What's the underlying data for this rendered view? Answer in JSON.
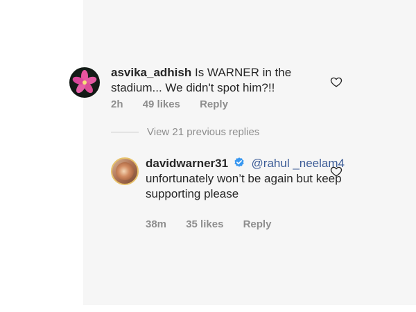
{
  "comment": {
    "username": "asvika_adhish",
    "text": "Is WARNER in the stadium... We didn't spot him?!!",
    "time": "2h",
    "likes": "49 likes",
    "reply_label": "Reply",
    "avatar": "pink-flower-avatar"
  },
  "thread": {
    "view_replies": "View 21 previous replies"
  },
  "reply": {
    "username": "davidwarner31",
    "verified": true,
    "mention": "@rahul _neelam4",
    "text": "unfortunately won’t be again but keep supporting please",
    "time": "38m",
    "likes": "35 likes",
    "reply_label": "Reply",
    "avatar": "profile-photo-avatar"
  },
  "icons": {
    "like": "heart-outline-icon",
    "verified": "verified-badge-icon"
  },
  "colors": {
    "text": "#262626",
    "meta": "#8e8e8e",
    "mention": "#3b5b96",
    "verified": "#3897f0"
  }
}
